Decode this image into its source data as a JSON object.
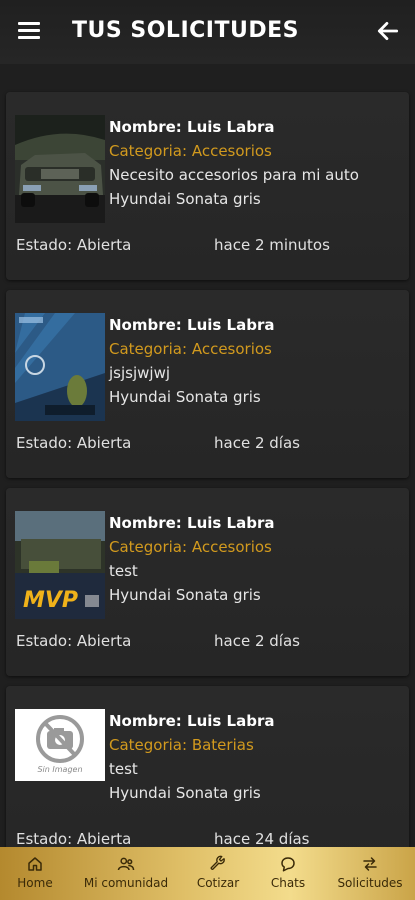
{
  "header": {
    "title": "TUS SOLICITUDES"
  },
  "requests": [
    {
      "name": "Nombre: Luis Labra",
      "category": "Categoria: Accesorios",
      "description": "Necesito accesorios para mi auto",
      "car": "Hyundai Sonata gris",
      "status": "Estado: Abierta",
      "time": "hace 2 minutos",
      "image": "car-photo"
    },
    {
      "name": "Nombre: Luis Labra",
      "category": "Categoria: Accesorios",
      "description": "jsjsjwjwj",
      "car": "Hyundai Sonata gris",
      "status": "Estado: Abierta",
      "time": "hace 2 días",
      "image": "game-screenshot"
    },
    {
      "name": "Nombre: Luis Labra",
      "category": "Categoria: Accesorios",
      "description": "test",
      "car": "Hyundai Sonata gris",
      "status": "Estado: Abierta",
      "time": "hace 2 días",
      "image": "mvp-screenshot"
    },
    {
      "name": "Nombre: Luis Labra",
      "category": "Categoria: Baterias",
      "description": "test",
      "car": "Hyundai Sonata gris",
      "status": "Estado: Abierta",
      "time": "hace 24 días",
      "image": "placeholder",
      "placeholder_text": "Sin Imagen"
    }
  ],
  "nav": [
    {
      "label": "Home",
      "icon": "home-icon"
    },
    {
      "label": "Mi comunidad",
      "icon": "community-icon"
    },
    {
      "label": "Cotizar",
      "icon": "wrench-icon"
    },
    {
      "label": "Chats",
      "icon": "chat-icon"
    },
    {
      "label": "Solicitudes",
      "icon": "swap-icon"
    }
  ]
}
